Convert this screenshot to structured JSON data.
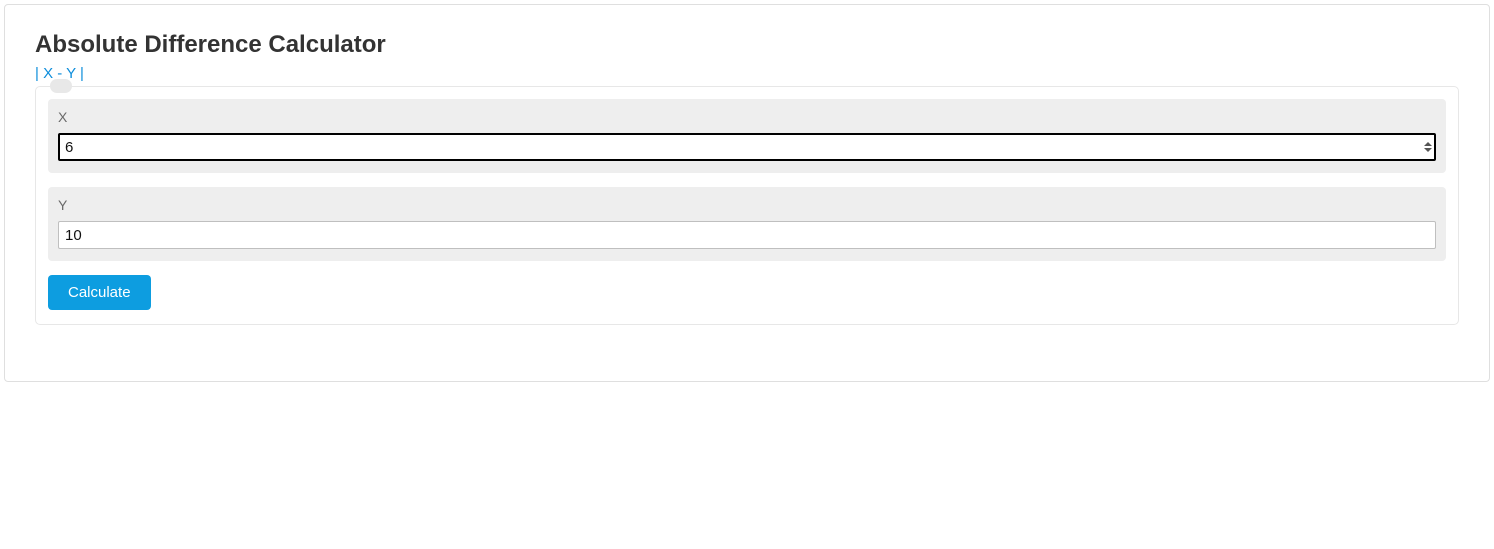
{
  "title": "Absolute Difference Calculator",
  "formula": "| X - Y |",
  "fields": {
    "x": {
      "label": "X",
      "value": "6"
    },
    "y": {
      "label": "Y",
      "value": "10"
    }
  },
  "button": {
    "label": "Calculate"
  }
}
